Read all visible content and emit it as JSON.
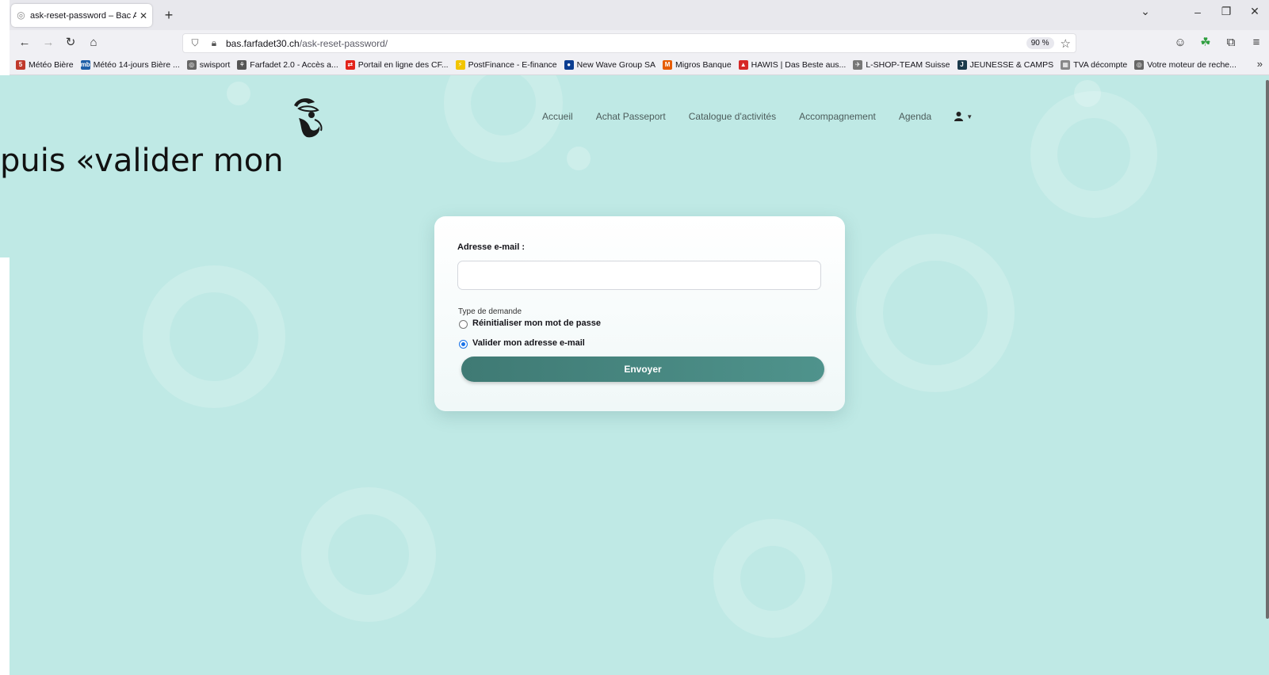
{
  "browser": {
    "tab_title": "ask-reset-password – Bac A Sab",
    "url_host": "bas.farfadet30.ch",
    "url_path": "/ask-reset-password/",
    "zoom": "90 %",
    "bookmarks": [
      {
        "label": "Météo Bière",
        "icon_color": "#c0392b",
        "glyph": "5"
      },
      {
        "label": "Météo 14-jours Bière ...",
        "icon_color": "#1f5fa8",
        "glyph": "mb"
      },
      {
        "label": "swisport",
        "icon_color": "#666666",
        "glyph": "◎"
      },
      {
        "label": "Farfadet 2.0 - Accès a...",
        "icon_color": "#555555",
        "glyph": "⚘"
      },
      {
        "label": "Portail en ligne des CF...",
        "icon_color": "#e3241b",
        "glyph": "⇄"
      },
      {
        "label": "PostFinance - E-finance",
        "icon_color": "#f2c500",
        "glyph": "⚡"
      },
      {
        "label": "New Wave Group SA",
        "icon_color": "#0b3d91",
        "glyph": "●"
      },
      {
        "label": "Migros Banque",
        "icon_color": "#e65c00",
        "glyph": "M"
      },
      {
        "label": "HAWIS | Das Beste aus...",
        "icon_color": "#d62828",
        "glyph": "▲"
      },
      {
        "label": "L-SHOP-TEAM Suisse",
        "icon_color": "#777777",
        "glyph": "✈"
      },
      {
        "label": "JEUNESSE & CAMPS",
        "icon_color": "#1b3a4b",
        "glyph": "J"
      },
      {
        "label": "TVA décompte",
        "icon_color": "#888888",
        "glyph": "▦"
      },
      {
        "label": "Votre moteur de reche...",
        "icon_color": "#666666",
        "glyph": "◎"
      }
    ]
  },
  "site": {
    "nav": [
      "Accueil",
      "Achat Passeport",
      "Catalogue d'activités",
      "Accompagnement",
      "Agenda"
    ],
    "overlay_text": "puis «valider mon"
  },
  "form": {
    "email_label": "Adresse e-mail :",
    "email_value": "",
    "type_label": "Type de demande",
    "options": [
      {
        "label": "Réinitialiser mon mot de passe",
        "checked": false
      },
      {
        "label": "Valider mon adresse e-mail",
        "checked": true
      }
    ],
    "submit_label": "Envoyer"
  },
  "colors": {
    "site_background": "#bfe9e5",
    "button": "#3f7a74",
    "radio_accent": "#1a73e8"
  }
}
